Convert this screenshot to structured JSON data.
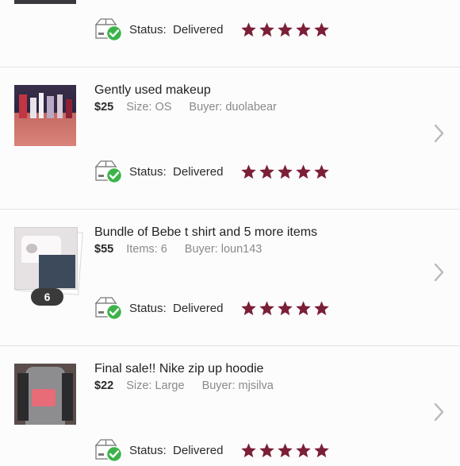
{
  "colors": {
    "star": "#7b1f36",
    "check": "#3cb34a",
    "chevron": "#b8b8b8"
  },
  "rows": [
    {
      "status_label": "Status:",
      "status_value": "Delivered",
      "rating": 5
    },
    {
      "title": "Gently used makeup",
      "price": "$25",
      "meta1": "Size: OS",
      "meta2": "Buyer: duolabear",
      "status_label": "Status:",
      "status_value": "Delivered",
      "rating": 5
    },
    {
      "title": "Bundle of Bebe t shirt and 5 more items",
      "price": "$55",
      "meta1": "Items: 6",
      "meta2": "Buyer: loun143",
      "badge": "6",
      "status_label": "Status:",
      "status_value": "Delivered",
      "rating": 5
    },
    {
      "title": "Final sale!! Nike zip up hoodie",
      "price": "$22",
      "meta1": "Size: Large",
      "meta2": "Buyer: mjsilva",
      "status_label": "Status:",
      "status_value": "Delivered",
      "rating": 5
    }
  ]
}
